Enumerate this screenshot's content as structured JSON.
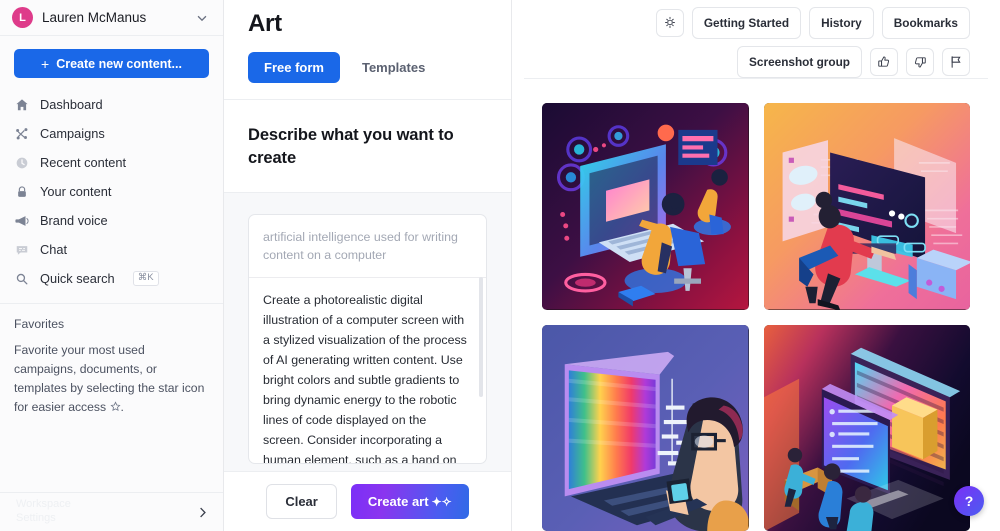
{
  "sidebar": {
    "user": {
      "name": "Lauren McManus",
      "initial": "L",
      "avatar_color": "#de3b8a"
    },
    "create_button": {
      "label": "Create new content...",
      "icon": "plus-icon",
      "color": "#1a68e8"
    },
    "nav_items": [
      {
        "label": "Dashboard",
        "icon": "home-icon"
      },
      {
        "label": "Campaigns",
        "icon": "campaigns-icon"
      },
      {
        "label": "Recent content",
        "icon": "clock-icon"
      },
      {
        "label": "Your content",
        "icon": "lock-icon"
      },
      {
        "label": "Brand voice",
        "icon": "megaphone-icon"
      },
      {
        "label": "Chat",
        "icon": "chat-icon"
      },
      {
        "label": "Quick search",
        "icon": "search-icon",
        "shortcut": "⌘K"
      }
    ],
    "favorites": {
      "title": "Favorites",
      "empty_text_before": "Favorite your most used campaigns, documents, or templates by selecting the star icon for easier access",
      "empty_text_after": "."
    },
    "footer": {
      "ghost_label": "Workspace\nSettings",
      "icon": "chevron-right-icon"
    }
  },
  "header": {
    "title": "Art",
    "tabs": [
      {
        "label": "Free form",
        "active": true
      },
      {
        "label": "Templates",
        "active": false
      }
    ],
    "actions": [
      {
        "label": "Getting Started",
        "type": "pill"
      },
      {
        "label": "History",
        "type": "pill"
      },
      {
        "label": "Bookmarks",
        "type": "pill"
      }
    ],
    "tips_icon": "lightbulb-icon"
  },
  "describe": {
    "heading": "Describe what you want to create",
    "placeholder": "artificial intelligence used for writing content on a computer",
    "value": "Create a photorealistic digital illustration of a computer screen with a stylized visualization of the process of AI generating written content. Use bright colors and subtle gradients to bring dynamic energy to the robotic lines of code displayed on the screen. Consider incorporating a human element, such as a hand on the mouse or keyboard, to personalize the experience."
  },
  "footer_actions": {
    "clear_label": "Clear",
    "create_label": "Create art",
    "create_icon": "sparkle-icon",
    "create_gradient_from": "#7b2ff7",
    "create_gradient_to": "#2f6ae6"
  },
  "results": {
    "group_label": "Screenshot group",
    "thumbs_up_icon": "thumbs-up-icon",
    "thumbs_down_icon": "thumbs-down-icon",
    "flag_icon": "flag-icon",
    "images": [
      {
        "alt": "Isometric illustration of person at computer with neon purple interface",
        "theme": "purple-red"
      },
      {
        "alt": "Isometric illustration of person at monitor with code, orange pink gradient",
        "theme": "orange-pink"
      },
      {
        "alt": "Illustration of man with glasses facing large colorful monitor",
        "theme": "blue-violet"
      },
      {
        "alt": "Isometric illustration of team viewing large screens with folder",
        "theme": "orange-navy"
      }
    ]
  },
  "help": {
    "label": "?",
    "icon": "question-icon"
  }
}
